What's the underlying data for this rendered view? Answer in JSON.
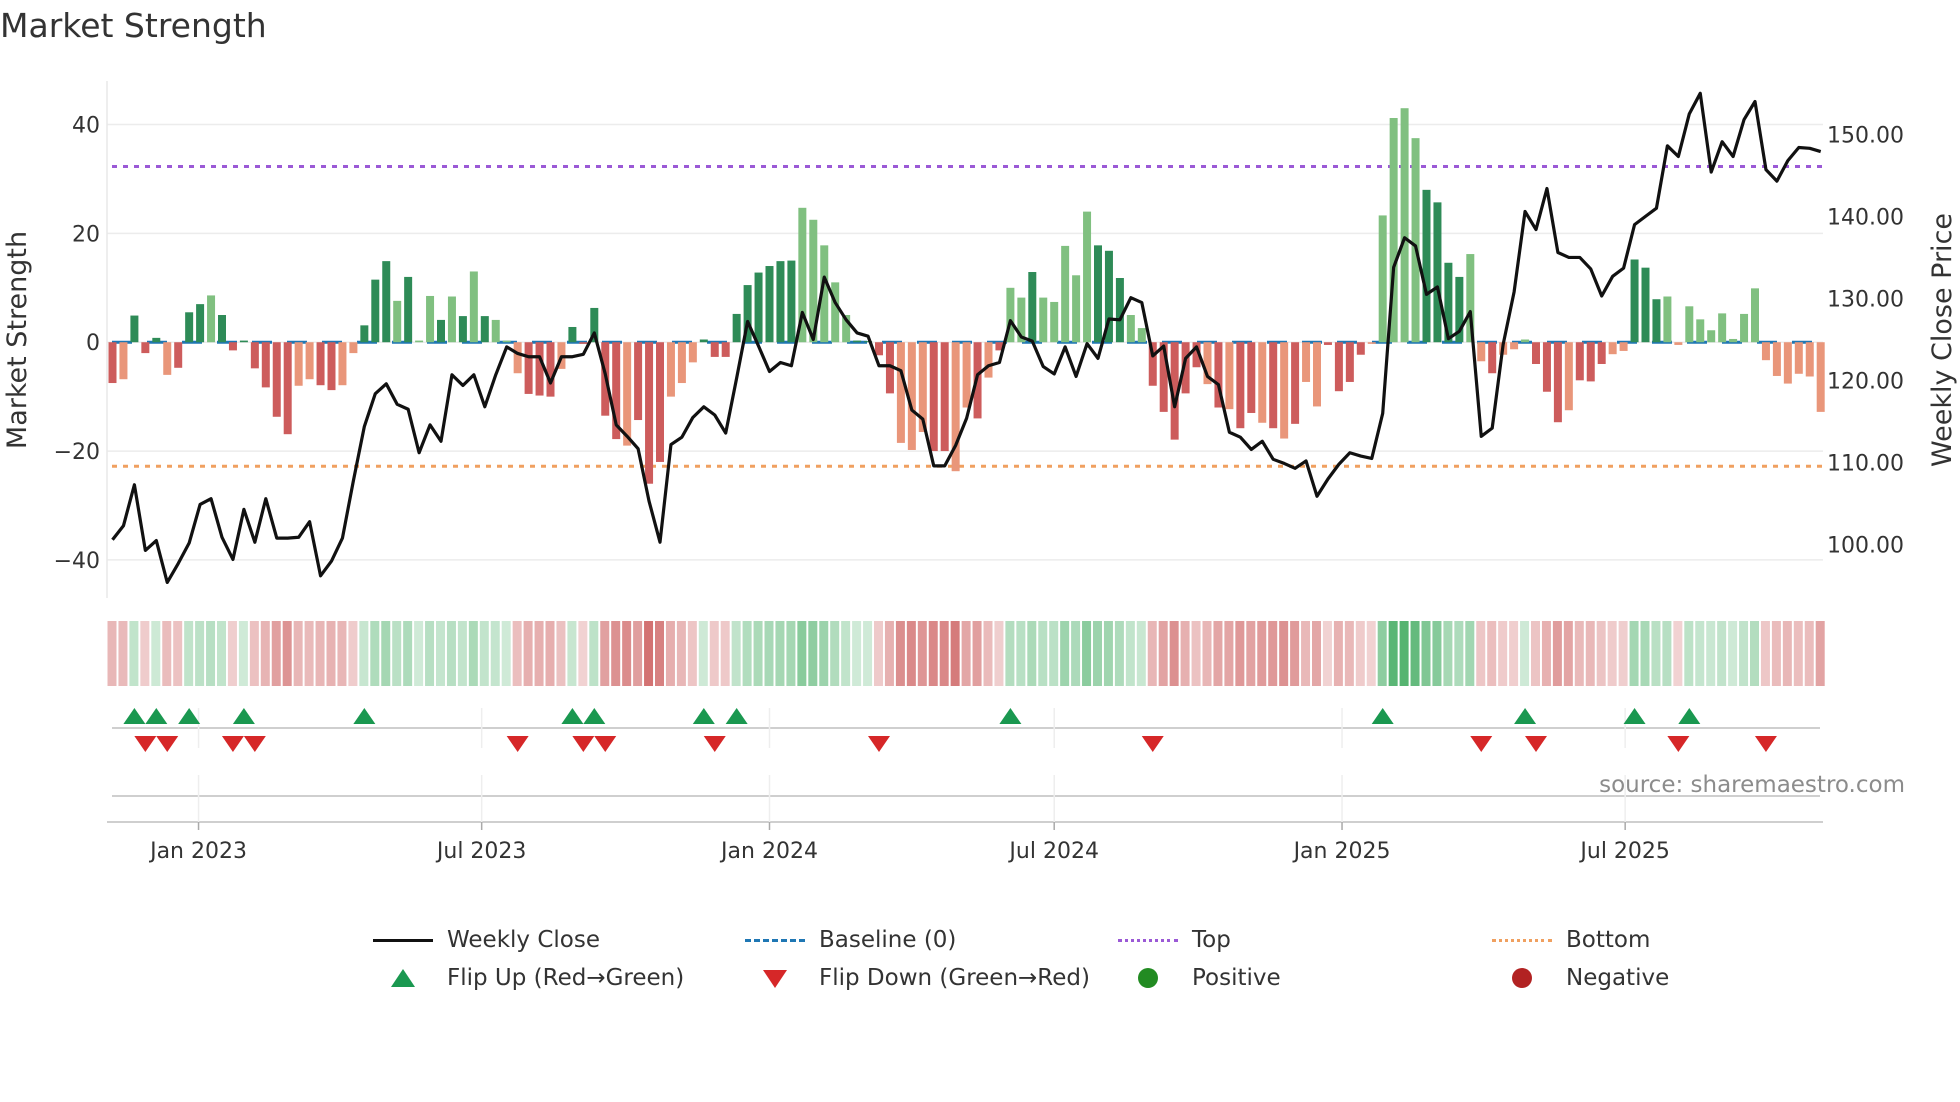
{
  "title": "Market Strength",
  "source": "source: sharemaestro.com",
  "legend": {
    "weekly_close": "Weekly Close",
    "baseline": "Baseline (0)",
    "top": "Top",
    "bottom": "Bottom",
    "flip_up": "Flip Up (Red→Green)",
    "flip_down": "Flip Down (Green→Red)",
    "positive": "Positive",
    "negative": "Negative"
  },
  "colors": {
    "pos_dark": "#2e8b57",
    "pos_light": "#80c080",
    "neg_dark": "#cd5c5c",
    "neg_light": "#e9967a",
    "close": "#111111",
    "baseline": "#1f77b4",
    "top": "#9b59d6",
    "bottom": "#f0a060",
    "flip_up": "#1a9850",
    "flip_down": "#d62728",
    "positive": "#228b22",
    "negative": "#b22222"
  },
  "chart_data": {
    "type": "bar",
    "title": "Market Strength",
    "ylabel": "Market Strength",
    "y2label": "Weekly Close Price",
    "ylim": [
      -47,
      48
    ],
    "y2lim": [
      93.5,
      156.5
    ],
    "yticks": [
      {
        "v": -40,
        "label": "−40"
      },
      {
        "v": -20,
        "label": "−20"
      },
      {
        "v": 0,
        "label": "0"
      },
      {
        "v": 20,
        "label": "20"
      },
      {
        "v": 40,
        "label": "40"
      }
    ],
    "y2ticks": [
      {
        "v": 100,
        "label": "100.00"
      },
      {
        "v": 110,
        "label": "110.00"
      },
      {
        "v": 120,
        "label": "120.00"
      },
      {
        "v": 130,
        "label": "130.00"
      },
      {
        "v": 140,
        "label": "140.00"
      },
      {
        "v": 150,
        "label": "150.00"
      }
    ],
    "xticks": [
      {
        "date": "2023-01-01",
        "label": "Jan 2023"
      },
      {
        "date": "2023-07-01",
        "label": "Jul 2023"
      },
      {
        "date": "2024-01-01",
        "label": "Jan 2024"
      },
      {
        "date": "2024-07-01",
        "label": "Jul 2024"
      },
      {
        "date": "2025-01-01",
        "label": "Jan 2025"
      },
      {
        "date": "2025-07-01",
        "label": "Jul 2025"
      }
    ],
    "start_date": "2022-11-07",
    "frequency": "weekly",
    "top_level": 32.3,
    "bottom_level": -22.8,
    "strength": [
      -7.5,
      -6.8,
      4.9,
      -2,
      0.8,
      -6,
      -4.7,
      5.5,
      7,
      8.6,
      5,
      -1.5,
      0.3,
      -4.8,
      -8.3,
      -13.7,
      -16.9,
      -8,
      -6.8,
      -7.9,
      -8.8,
      -7.9,
      -2,
      3.1,
      11.5,
      14.9,
      7.6,
      12,
      0.3,
      8.5,
      4.1,
      8.4,
      4.8,
      13,
      4.8,
      4.1,
      0.3,
      -5.7,
      -9.5,
      -9.8,
      -10,
      -4.9,
      2.8,
      -0.3,
      6.3,
      -13.5,
      -17.8,
      -19,
      -14.3,
      -26,
      -22,
      -10,
      -7.5,
      -3.7,
      0.5,
      -2.7,
      -2.7,
      5.2,
      10.5,
      12.8,
      14,
      14.9,
      15,
      24.7,
      22.5,
      17.8,
      11,
      5,
      0.3,
      0.2,
      -2.4,
      -9.4,
      -18.5,
      -19.8,
      -16.5,
      -20,
      -20,
      -23.7,
      -12,
      -14,
      -6.5,
      -1.5,
      10,
      8.2,
      12.9,
      8.2,
      7.4,
      17.7,
      12.3,
      24,
      17.8,
      16.8,
      11.8,
      5,
      2.6,
      -8,
      -12.8,
      -17.9,
      -9.4,
      -4.6,
      -7.7,
      -12,
      -12.3,
      -15.8,
      -13,
      -14.8,
      -15.8,
      -17.7,
      -15,
      -7.3,
      -11.8,
      -0.5,
      -9,
      -7.3,
      -2.3,
      -0.3,
      23.3,
      41.2,
      43,
      37.5,
      28,
      25.7,
      14.6,
      12,
      16.2,
      -3.5,
      -5.7,
      -2.3,
      -1.3,
      0.5,
      -4,
      -9.1,
      -14.7,
      -12.5,
      -7,
      -7.2,
      -4,
      -2.2,
      -1.6,
      15.2,
      13.7,
      7.9,
      8.4,
      -0.5,
      6.6,
      4.2,
      2.2,
      5.3,
      0.6,
      5.2,
      9.9,
      -3.3,
      -6.2,
      -7.6,
      -5.8,
      -6.3,
      -12.8
    ],
    "tone": "dldddldddldddddddllddlldddldlldldldllldddldddddldddllldddddddddlllllddddlllddlldldlldllllldddlldddddldlddldldllddddlllllddddlldllldddldddlldddl",
    "weekly_close": [
      100.6,
      102.3,
      107.3,
      99.3,
      100.5,
      95.4,
      97.7,
      100.2,
      104.9,
      105.6,
      100.9,
      98.2,
      104.3,
      100.3,
      105.6,
      100.8,
      100.8,
      100.9,
      102.8,
      96.2,
      98.0,
      100.8,
      107.8,
      114.4,
      118.4,
      119.6,
      117.1,
      116.5,
      111.2,
      114.6,
      112.6,
      120.7,
      119.4,
      120.7,
      116.8,
      120.7,
      124.1,
      123.3,
      122.9,
      122.9,
      119.7,
      122.9,
      122.9,
      123.2,
      125.8,
      120.8,
      114.6,
      113.2,
      111.7,
      105.3,
      100.3,
      112.2,
      113.1,
      115.5,
      116.8,
      115.8,
      113.6,
      120.3,
      127.2,
      124.2,
      121.1,
      122.2,
      121.8,
      128.3,
      125.0,
      132.6,
      129.5,
      127.4,
      125.8,
      125.4,
      121.8,
      121.8,
      121.2,
      116.4,
      115.3,
      109.6,
      109.6,
      112.1,
      115.4,
      120.7,
      121.8,
      122.2,
      127.3,
      125.3,
      124.8,
      121.7,
      120.8,
      124.1,
      120.5,
      124.5,
      122.7,
      127.5,
      127.4,
      130.1,
      129.5,
      123.0,
      124.2,
      116.8,
      122.7,
      124.1,
      120.5,
      119.5,
      113.7,
      113.1,
      111.6,
      112.6,
      110.4,
      109.9,
      109.3,
      110.2,
      105.9,
      108.0,
      109.8,
      111.2,
      110.8,
      110.5,
      116.0,
      133.8,
      137.4,
      136.4,
      130.5,
      131.4,
      125.1,
      126.0,
      128.4,
      113.2,
      114.2,
      124.4,
      130.8,
      140.6,
      138.4,
      143.4,
      135.6,
      135.0,
      135.0,
      133.6,
      130.3,
      132.7,
      133.7,
      139.0,
      140.0,
      141.0,
      148.6,
      147.3,
      152.5,
      155.0,
      145.4,
      149.1,
      147.3,
      151.8,
      154.0,
      145.7,
      144.3,
      146.8,
      148.4,
      148.3,
      147.9
    ],
    "flip_up_weeks": [
      2,
      4,
      7,
      12,
      23,
      42,
      44,
      54,
      57,
      82,
      116,
      129,
      139,
      144
    ],
    "flip_down_weeks": [
      3,
      5,
      11,
      13,
      37,
      43,
      45,
      55,
      70,
      95,
      125,
      130,
      143,
      151
    ]
  }
}
